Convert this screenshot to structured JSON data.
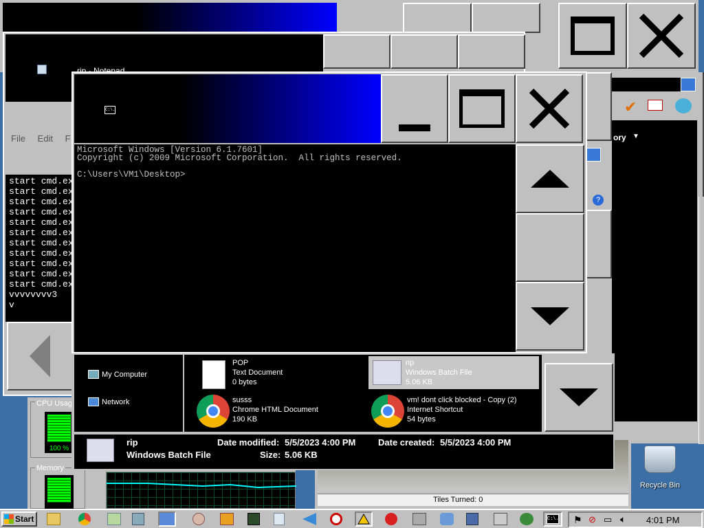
{
  "window_back": {
    "title": ""
  },
  "notepad": {
    "title": "rip - Notepad",
    "menu": [
      "File",
      "Edit",
      "F"
    ],
    "lines": [
      "start cmd.ex",
      "start cmd.ex",
      "start cmd.ex",
      "start cmd.ex",
      "start cmd.ex",
      "start cmd.ex",
      "start cmd.ex",
      "start cmd.ex",
      "start cmd.ex",
      "start cmd.ex",
      "start cmd.ex",
      "vvvvvvvv3",
      "v"
    ]
  },
  "cmd": {
    "icon_label": "C:\\.",
    "lines": [
      "Microsoft Windows [Version 6.1.7601]",
      "Copyright (c) 2009 Microsoft Corporation.  All rights reserved.",
      "",
      "C:\\Users\\VM1\\Desktop>"
    ],
    "minimize_glyph": "_",
    "maximize_glyph": "☐",
    "close_glyph": "✕"
  },
  "explorer": {
    "menu_partial": "ory",
    "nav": [
      {
        "label": "My Computer"
      },
      {
        "label": "Network"
      }
    ],
    "files": [
      {
        "name": "POP",
        "type": "Text Document",
        "size": "0 bytes",
        "icon": "text-document-icon"
      },
      {
        "name": "rip",
        "type": "Windows Batch File",
        "size": "5.06 KB",
        "icon": "batch-file-icon",
        "selected": true
      },
      {
        "name": "susss",
        "type": "Chrome HTML Document",
        "size": "190 KB",
        "icon": "chrome-icon"
      },
      {
        "name": "vm! dont click blocked - Copy (2)",
        "type": "Internet Shortcut",
        "size": "54 bytes",
        "icon": "chrome-shortcut-icon"
      }
    ],
    "details": {
      "name": "rip",
      "type": "Windows Batch File",
      "modified_label": "Date modified:",
      "modified": "5/5/2023 4:00 PM",
      "created_label": "Date created:",
      "created": "5/5/2023 4:00 PM",
      "size_label": "Size:",
      "size": "5.06 KB"
    }
  },
  "taskmgr": {
    "cpu_label": "CPU Usage",
    "cpu_value": "100 %",
    "memory_label": "Memory",
    "cpu_fraction": 1.0
  },
  "game": {
    "status": "Tiles Turned: 0"
  },
  "desktop": {
    "recycle_bin": "Recycle Bin"
  },
  "taskbar": {
    "start": "Start",
    "clock": "4:01 PM"
  },
  "colors": {
    "title_active_start": "#000000",
    "title_active_end": "#0000ff",
    "accent": "#0000cc"
  }
}
